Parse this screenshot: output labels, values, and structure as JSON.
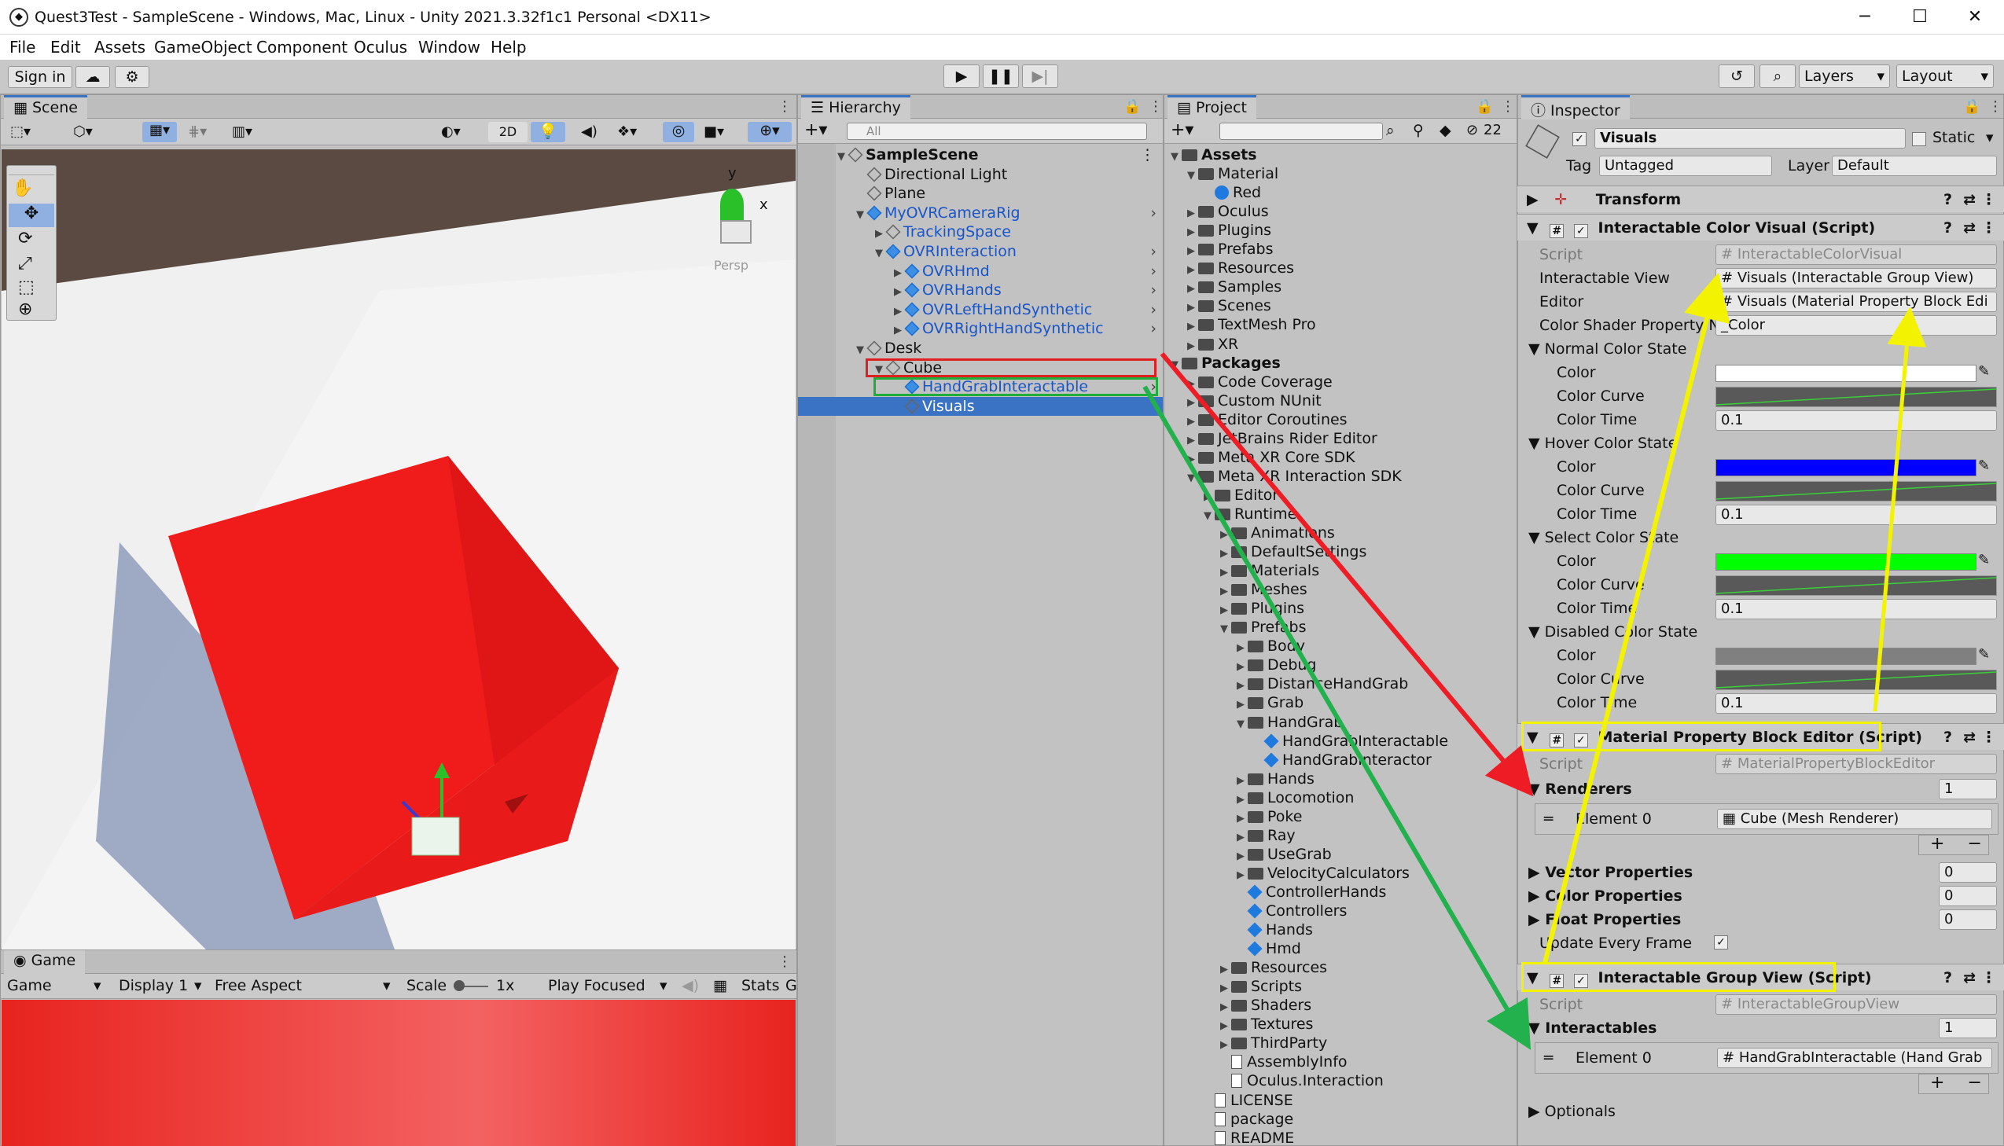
{
  "window": {
    "title": "Quest3Test - SampleScene - Windows, Mac, Linux - Unity 2021.3.32f1c1 Personal <DX11>",
    "controls": [
      "─",
      "☐",
      "✕"
    ]
  },
  "menu": [
    "File",
    "Edit",
    "Assets",
    "GameObject",
    "Component",
    "Oculus",
    "Window",
    "Help"
  ],
  "toolbar": {
    "sign_in": "Sign in",
    "layers": "Layers",
    "layout": "Layout"
  },
  "scene": {
    "tab": "Scene",
    "mode_2d": "2D",
    "persp": "Persp",
    "axis_y": "y",
    "axis_x": "x"
  },
  "game": {
    "tab": "Game",
    "mode": "Game",
    "display": "Display 1",
    "aspect": "Free Aspect",
    "scale_label": "Scale",
    "scale_value": "1x",
    "play_focused": "Play Focused",
    "stats": "Stats",
    "gizmos": "G"
  },
  "hierarchy": {
    "tab": "Hierarchy",
    "search_placeholder": "All",
    "items": [
      {
        "label": "SampleScene",
        "indent": 0,
        "tri": "▼",
        "icon": "unity",
        "bold": true
      },
      {
        "label": "Directional Light",
        "indent": 1,
        "tri": "",
        "icon": "cube"
      },
      {
        "label": "Plane",
        "indent": 1,
        "tri": "",
        "icon": "cube"
      },
      {
        "label": "MyOVRCameraRig",
        "indent": 1,
        "tri": "▼",
        "icon": "prefab",
        "blue": true,
        "more": true
      },
      {
        "label": "TrackingSpace",
        "indent": 2,
        "tri": "▶",
        "icon": "cube",
        "blue": true
      },
      {
        "label": "OVRInteraction",
        "indent": 2,
        "tri": "▼",
        "icon": "prefab",
        "blue": true,
        "more": true
      },
      {
        "label": "OVRHmd",
        "indent": 3,
        "tri": "▶",
        "icon": "prefab",
        "blue": true,
        "more": true
      },
      {
        "label": "OVRHands",
        "indent": 3,
        "tri": "▶",
        "icon": "prefab",
        "blue": true,
        "more": true
      },
      {
        "label": "OVRLeftHandSynthetic",
        "indent": 3,
        "tri": "▶",
        "icon": "prefab",
        "blue": true,
        "more": true
      },
      {
        "label": "OVRRightHandSynthetic",
        "indent": 3,
        "tri": "▶",
        "icon": "prefab",
        "blue": true,
        "more": true
      },
      {
        "label": "Desk",
        "indent": 1,
        "tri": "▼",
        "icon": "cube"
      },
      {
        "label": "Cube",
        "indent": 2,
        "tri": "▼",
        "icon": "cube",
        "boxed": "red"
      },
      {
        "label": "HandGrabInteractable",
        "indent": 3,
        "tri": "",
        "icon": "prefab",
        "blue": true,
        "more": true,
        "boxed": "green"
      },
      {
        "label": "Visuals",
        "indent": 3,
        "tri": "",
        "icon": "cube",
        "selected": true
      }
    ]
  },
  "project": {
    "tab": "Project",
    "badge": "22",
    "items": [
      {
        "label": "Assets",
        "indent": 0,
        "tri": "▼",
        "icon": "folder",
        "bold": true
      },
      {
        "label": "Material",
        "indent": 1,
        "tri": "▼",
        "icon": "folder"
      },
      {
        "label": "Red",
        "indent": 2,
        "tri": "",
        "icon": "material"
      },
      {
        "label": "Oculus",
        "indent": 1,
        "tri": "▶",
        "icon": "folder"
      },
      {
        "label": "Plugins",
        "indent": 1,
        "tri": "▶",
        "icon": "folder"
      },
      {
        "label": "Prefabs",
        "indent": 1,
        "tri": "▶",
        "icon": "folder"
      },
      {
        "label": "Resources",
        "indent": 1,
        "tri": "▶",
        "icon": "folder"
      },
      {
        "label": "Samples",
        "indent": 1,
        "tri": "▶",
        "icon": "folder"
      },
      {
        "label": "Scenes",
        "indent": 1,
        "tri": "▶",
        "icon": "folder"
      },
      {
        "label": "TextMesh Pro",
        "indent": 1,
        "tri": "▶",
        "icon": "folder"
      },
      {
        "label": "XR",
        "indent": 1,
        "tri": "▶",
        "icon": "folder"
      },
      {
        "label": "Packages",
        "indent": 0,
        "tri": "▼",
        "icon": "folder",
        "bold": true
      },
      {
        "label": "Code Coverage",
        "indent": 1,
        "tri": "▶",
        "icon": "folder"
      },
      {
        "label": "Custom NUnit",
        "indent": 1,
        "tri": "▶",
        "icon": "folder"
      },
      {
        "label": "Editor Coroutines",
        "indent": 1,
        "tri": "▶",
        "icon": "folder"
      },
      {
        "label": "JetBrains Rider Editor",
        "indent": 1,
        "tri": "▶",
        "icon": "folder"
      },
      {
        "label": "Meta XR Core SDK",
        "indent": 1,
        "tri": "▶",
        "icon": "folder"
      },
      {
        "label": "Meta XR Interaction SDK",
        "indent": 1,
        "tri": "▼",
        "icon": "folder"
      },
      {
        "label": "Editor",
        "indent": 2,
        "tri": "▶",
        "icon": "folder"
      },
      {
        "label": "Runtime",
        "indent": 2,
        "tri": "▼",
        "icon": "folder"
      },
      {
        "label": "Animations",
        "indent": 3,
        "tri": "▶",
        "icon": "folder"
      },
      {
        "label": "DefaultSettings",
        "indent": 3,
        "tri": "▶",
        "icon": "folder"
      },
      {
        "label": "Materials",
        "indent": 3,
        "tri": "▶",
        "icon": "folder"
      },
      {
        "label": "Meshes",
        "indent": 3,
        "tri": "▶",
        "icon": "folder"
      },
      {
        "label": "Plugins",
        "indent": 3,
        "tri": "▶",
        "icon": "folder"
      },
      {
        "label": "Prefabs",
        "indent": 3,
        "tri": "▼",
        "icon": "folder"
      },
      {
        "label": "Body",
        "indent": 4,
        "tri": "▶",
        "icon": "folder"
      },
      {
        "label": "Debug",
        "indent": 4,
        "tri": "▶",
        "icon": "folder"
      },
      {
        "label": "DistanceHandGrab",
        "indent": 4,
        "tri": "▶",
        "icon": "folder"
      },
      {
        "label": "Grab",
        "indent": 4,
        "tri": "▶",
        "icon": "folder"
      },
      {
        "label": "HandGrab",
        "indent": 4,
        "tri": "▼",
        "icon": "folder"
      },
      {
        "label": "HandGrabInteractable",
        "indent": 5,
        "tri": "",
        "icon": "prefab"
      },
      {
        "label": "HandGrabInteractor",
        "indent": 5,
        "tri": "",
        "icon": "prefab"
      },
      {
        "label": "Hands",
        "indent": 4,
        "tri": "▶",
        "icon": "folder"
      },
      {
        "label": "Locomotion",
        "indent": 4,
        "tri": "▶",
        "icon": "folder"
      },
      {
        "label": "Poke",
        "indent": 4,
        "tri": "▶",
        "icon": "folder"
      },
      {
        "label": "Ray",
        "indent": 4,
        "tri": "▶",
        "icon": "folder"
      },
      {
        "label": "UseGrab",
        "indent": 4,
        "tri": "▶",
        "icon": "folder"
      },
      {
        "label": "VelocityCalculators",
        "indent": 4,
        "tri": "▶",
        "icon": "folder"
      },
      {
        "label": "ControllerHands",
        "indent": 4,
        "tri": "",
        "icon": "prefab"
      },
      {
        "label": "Controllers",
        "indent": 4,
        "tri": "",
        "icon": "prefab"
      },
      {
        "label": "Hands",
        "indent": 4,
        "tri": "",
        "icon": "prefab"
      },
      {
        "label": "Hmd",
        "indent": 4,
        "tri": "",
        "icon": "prefab"
      },
      {
        "label": "Resources",
        "indent": 3,
        "tri": "▶",
        "icon": "folder"
      },
      {
        "label": "Scripts",
        "indent": 3,
        "tri": "▶",
        "icon": "folder"
      },
      {
        "label": "Shaders",
        "indent": 3,
        "tri": "▶",
        "icon": "folder"
      },
      {
        "label": "Textures",
        "indent": 3,
        "tri": "▶",
        "icon": "folder"
      },
      {
        "label": "ThirdParty",
        "indent": 3,
        "tri": "▶",
        "icon": "folder"
      },
      {
        "label": "AssemblyInfo",
        "indent": 3,
        "tri": "",
        "icon": "script"
      },
      {
        "label": "Oculus.Interaction",
        "indent": 3,
        "tri": "",
        "icon": "asmdef"
      },
      {
        "label": "LICENSE",
        "indent": 2,
        "tri": "",
        "icon": "file"
      },
      {
        "label": "package",
        "indent": 2,
        "tri": "",
        "icon": "file"
      },
      {
        "label": "README",
        "indent": 2,
        "tri": "",
        "icon": "file"
      }
    ]
  },
  "inspector": {
    "tab": "Inspector",
    "object_name": "Visuals",
    "static_label": "Static",
    "tag_label": "Tag",
    "tag_value": "Untagged",
    "layer_label": "Layer",
    "layer_value": "Default",
    "transform": "Transform",
    "icv": {
      "header": "Interactable Color Visual (Script)",
      "script_label": "Script",
      "script_value": "InteractableColorVisual",
      "iv_label": "Interactable View",
      "iv_value": "Visuals (Interactable Group View)",
      "editor_label": "Editor",
      "editor_value": "Visuals (Material Property Block Edi",
      "csp_label": "Color Shader Property N",
      "csp_value": "_Color",
      "states": [
        {
          "name": "Normal Color State",
          "color": "#ffffff",
          "time": "0.1"
        },
        {
          "name": "Hover Color State",
          "color": "#0000ff",
          "time": "0.1"
        },
        {
          "name": "Select Color State",
          "color": "#00ff00",
          "time": "0.1"
        },
        {
          "name": "Disabled Color State",
          "color": "#808080",
          "time": "0.1"
        }
      ],
      "color_label": "Color",
      "curve_label": "Color Curve",
      "time_label": "Color Time"
    },
    "mpbe": {
      "header": "Material Property Block Editor (Script)",
      "script_label": "Script",
      "script_value": "MaterialPropertyBlockEditor",
      "renderers_label": "Renderers",
      "renderers_count": "1",
      "element_label": "Element 0",
      "element_value": "Cube (Mesh Renderer)",
      "vector_label": "Vector Properties",
      "vector_count": "0",
      "color_label": "Color Properties",
      "color_count": "0",
      "float_label": "Float Properties",
      "float_count": "0",
      "update_label": "Update Every Frame",
      "plus": "+",
      "minus": "−"
    },
    "igv": {
      "header": "Interactable Group View (Script)",
      "script_label": "Script",
      "script_value": "InteractableGroupView",
      "inter_label": "Interactables",
      "inter_count": "1",
      "element_label": "Element 0",
      "element_value": "HandGrabInteractable (Hand Grab",
      "optionals": "Optionals",
      "plus": "+",
      "minus": "−"
    }
  },
  "colors": {
    "accent": "#3a72c4",
    "selected_row": "#3a72c4",
    "red_box": "#e02020",
    "green_box": "#1fae3a",
    "yellow": "#f3f200",
    "arrow_red": "#ee1c24",
    "arrow_green": "#22b14c"
  }
}
